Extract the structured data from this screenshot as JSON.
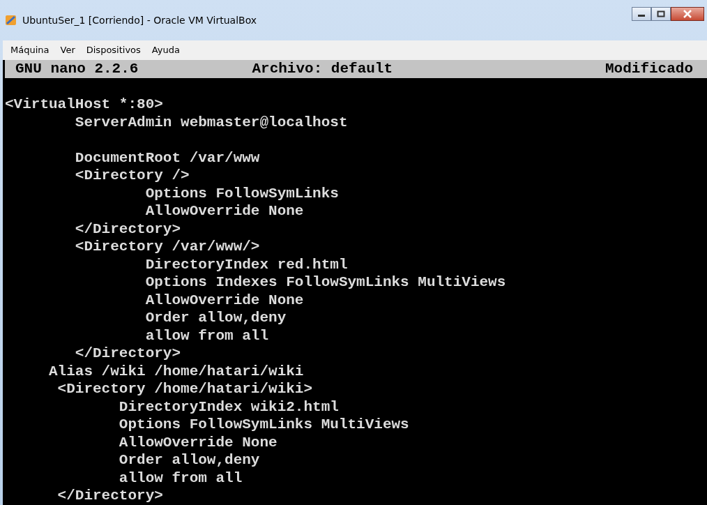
{
  "window": {
    "title": "UbuntuSer_1 [Corriendo] - Oracle VM VirtualBox"
  },
  "menu": [
    "Máquina",
    "Ver",
    "Dispositivos",
    "Ayuda"
  ],
  "nano_header": {
    "version": "GNU nano 2.2.6",
    "file": "Archivo: default",
    "status": "Modificado"
  },
  "lines": [
    {
      "kind": "blank"
    },
    {
      "kind": "text",
      "text": "<VirtualHost *:80>"
    },
    {
      "kind": "text",
      "text": "        ServerAdmin webmaster@localhost"
    },
    {
      "kind": "blank"
    },
    {
      "kind": "text",
      "text": "        DocumentRoot /var/www"
    },
    {
      "kind": "text",
      "text": "        <Directory />"
    },
    {
      "kind": "text",
      "text": "                Options FollowSymLinks"
    },
    {
      "kind": "text",
      "text": "                AllowOverride None"
    },
    {
      "kind": "text",
      "text": "        </Directory>"
    },
    {
      "kind": "text",
      "text": "        <Directory /var/www/>"
    },
    {
      "kind": "text",
      "text": "                DirectoryIndex red.html"
    },
    {
      "kind": "text",
      "text": "                Options Indexes FollowSymLinks MultiViews"
    },
    {
      "kind": "text",
      "text": "                AllowOverride None"
    },
    {
      "kind": "text",
      "text": "                Order allow,deny"
    },
    {
      "kind": "text",
      "text": "                allow from all"
    },
    {
      "kind": "text",
      "text": "        </Directory>"
    },
    {
      "kind": "text",
      "text": "     Alias /wiki /home/hatari/wiki"
    },
    {
      "kind": "text",
      "text": "      <Directory /home/hatari/wiki>"
    },
    {
      "kind": "text",
      "text": "             DirectoryIndex wiki2.html"
    },
    {
      "kind": "text",
      "text": "             Options FollowSymLinks MultiViews"
    },
    {
      "kind": "text",
      "text": "             AllowOverride None"
    },
    {
      "kind": "text",
      "text": "             Order allow,deny"
    },
    {
      "kind": "text",
      "text": "             allow from all"
    },
    {
      "kind": "text",
      "text": "      </Directory>"
    }
  ]
}
